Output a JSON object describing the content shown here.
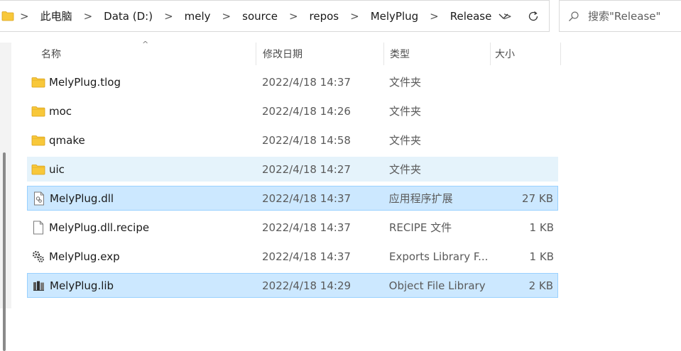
{
  "address_bar": {
    "breadcrumbs": [
      "此电脑",
      "Data (D:)",
      "mely",
      "source",
      "repos",
      "MelyPlug",
      "Release"
    ],
    "separator": ">",
    "dropdown_glyph": "chevron-down-icon",
    "refresh_glyph": "refresh-icon"
  },
  "search": {
    "placeholder": "搜索\"Release\""
  },
  "columns": {
    "name": "名称",
    "date": "修改日期",
    "type": "类型",
    "size": "大小"
  },
  "files": [
    {
      "name": "MelyPlug.tlog",
      "date": "2022/4/18 14:37",
      "type": "文件夹",
      "size": "",
      "icon": "folder-icon",
      "state": "normal"
    },
    {
      "name": "moc",
      "date": "2022/4/18 14:26",
      "type": "文件夹",
      "size": "",
      "icon": "folder-icon",
      "state": "normal"
    },
    {
      "name": "qmake",
      "date": "2022/4/18 14:58",
      "type": "文件夹",
      "size": "",
      "icon": "folder-icon",
      "state": "normal"
    },
    {
      "name": "uic",
      "date": "2022/4/18 14:27",
      "type": "文件夹",
      "size": "",
      "icon": "folder-icon",
      "state": "hover"
    },
    {
      "name": "MelyPlug.dll",
      "date": "2022/4/18 14:37",
      "type": "应用程序扩展",
      "size": "27 KB",
      "icon": "dll-file-icon",
      "state": "selected"
    },
    {
      "name": "MelyPlug.dll.recipe",
      "date": "2022/4/18 14:37",
      "type": "RECIPE 文件",
      "size": "1 KB",
      "icon": "blank-file-icon",
      "state": "normal"
    },
    {
      "name": "MelyPlug.exp",
      "date": "2022/4/18 14:37",
      "type": "Exports Library F...",
      "size": "1 KB",
      "icon": "exp-file-icon",
      "state": "normal"
    },
    {
      "name": "MelyPlug.lib",
      "date": "2022/4/18 14:29",
      "type": "Object File Library",
      "size": "2 KB",
      "icon": "lib-file-icon",
      "state": "selected"
    }
  ],
  "colors": {
    "folder": "#f8c83a",
    "selected_bg": "#cce8ff",
    "selected_border": "#99d1ff",
    "hover_bg": "#e5f3fb"
  }
}
